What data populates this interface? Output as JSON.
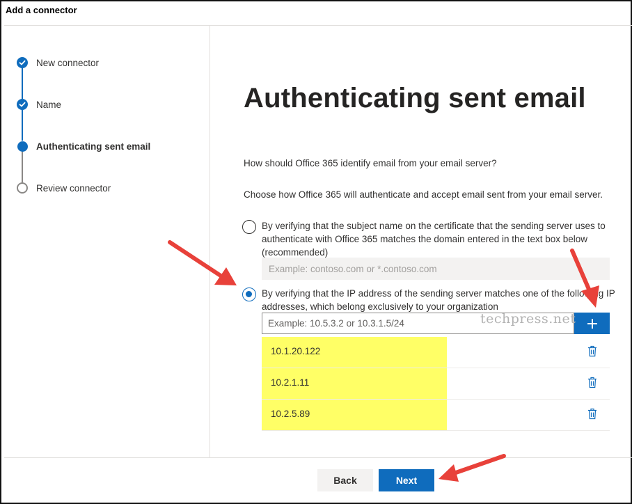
{
  "window": {
    "title": "Add a connector"
  },
  "steps": [
    {
      "label": "New connector",
      "state": "done"
    },
    {
      "label": "Name",
      "state": "done"
    },
    {
      "label": "Authenticating sent email",
      "state": "current"
    },
    {
      "label": "Review connector",
      "state": "todo"
    }
  ],
  "main": {
    "heading": "Authenticating sent email",
    "question": "How should Office 365 identify email from your email server?",
    "instruction": "Choose how Office 365 will authenticate and accept email sent from your email server.",
    "option_cert": {
      "label": "By verifying that the subject name on the certificate that the sending server uses to authenticate with Office 365 matches the domain entered in the text box below (recommended)",
      "placeholder": "Example: contoso.com or *.contoso.com",
      "selected": false
    },
    "option_ip": {
      "label": "By verifying that the IP address of the sending server matches one of the following IP addresses, which belong exclusively to your organization",
      "placeholder": "Example: 10.5.3.2 or 10.3.1.5/24",
      "selected": true
    },
    "ip_addresses": [
      "10.1.20.122",
      "10.2.1.11",
      "10.2.5.89"
    ],
    "add_icon": "plus-icon",
    "delete_icon": "trash-icon"
  },
  "watermark": "techpress.net",
  "footer": {
    "back_label": "Back",
    "next_label": "Next"
  },
  "colors": {
    "accent": "#0f6cbd",
    "highlight": "#ffff66",
    "annotation_arrow": "#e8413a"
  }
}
